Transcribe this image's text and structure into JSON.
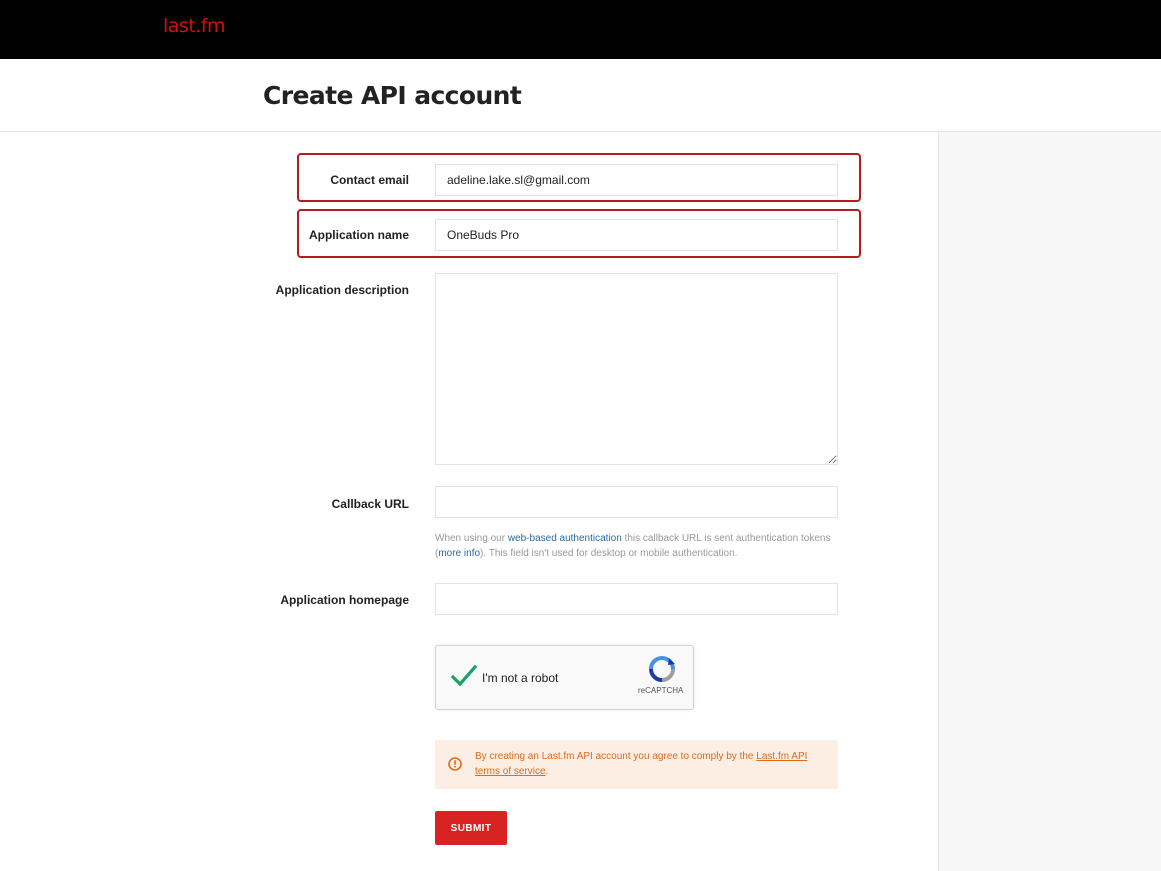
{
  "brand": {
    "logo_text": "last.fm",
    "accent": "#d51007"
  },
  "page": {
    "title": "Create API account"
  },
  "form": {
    "contact_email": {
      "label": "Contact email",
      "value": "adeline.lake.sl@gmail.com"
    },
    "app_name": {
      "label": "Application name",
      "value": "OneBuds Pro"
    },
    "app_description": {
      "label": "Application description",
      "value": ""
    },
    "callback_url": {
      "label": "Callback URL",
      "value": "",
      "help_prefix": "When using our ",
      "help_link": "web-based authentication",
      "help_mid": " this callback URL is sent authentication tokens (",
      "help_link2": "more info",
      "help_suffix": "). This field isn't used for desktop or mobile authentication."
    },
    "app_homepage": {
      "label": "Application homepage",
      "value": ""
    },
    "captcha": {
      "label": "I'm not a robot",
      "brand": "reCAPTCHA",
      "checked": true
    },
    "notice": {
      "prefix": "By creating an Last.fm API account you agree to comply by the ",
      "link": "Last.fm API terms of service",
      "suffix": "."
    },
    "submit_label": "SUBMIT"
  }
}
